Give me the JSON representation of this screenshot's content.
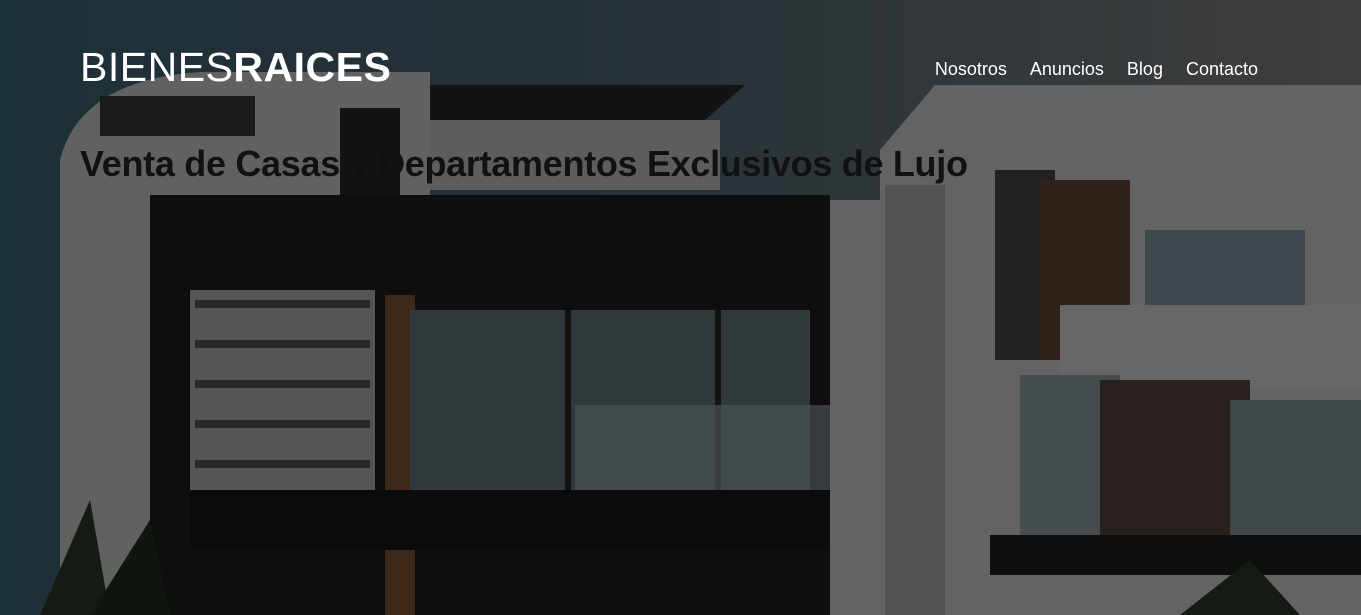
{
  "logo": {
    "light": "BIENES",
    "bold": "RAICES"
  },
  "nav": {
    "items": [
      {
        "label": "Nosotros"
      },
      {
        "label": "Anuncios"
      },
      {
        "label": "Blog"
      },
      {
        "label": "Contacto"
      }
    ]
  },
  "hero": {
    "title": "Venta de Casas y Departamentos Exclusivos de Lujo"
  },
  "colors": {
    "overlay": "#000000",
    "nav_text": "#ffffff",
    "title_text": "#111111"
  }
}
